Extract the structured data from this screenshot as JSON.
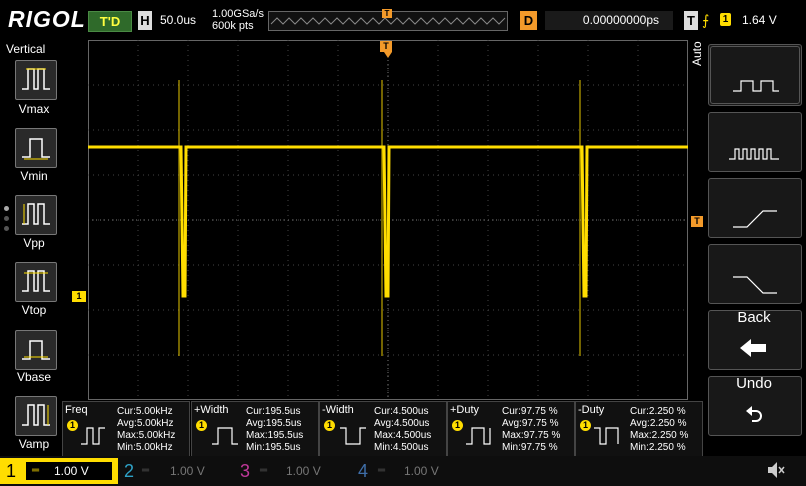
{
  "header": {
    "brand": "RIGOL",
    "run_status": "T'D",
    "horizontal_badge": "H",
    "timebase": "50.0us",
    "sample_rate": "1.00GSa/s",
    "memory_depth": "600k pts",
    "trigger_map_marker": "T",
    "delay_badge": "D",
    "delay_value": "0.00000000ps",
    "trigger_badge": "T",
    "trigger_edge": "⨍",
    "trigger_channel": "1",
    "trigger_level": "1.64 V"
  },
  "left_panel": {
    "title": "Vertical",
    "items": [
      {
        "label": "Vmax"
      },
      {
        "label": "Vmin"
      },
      {
        "label": "Vpp"
      },
      {
        "label": "Vtop"
      },
      {
        "label": "Vbase"
      },
      {
        "label": "Vamp"
      }
    ]
  },
  "waveform": {
    "top_marker": "T",
    "channel_marker": "1",
    "trigger_level_marker": "T"
  },
  "right_panel": {
    "mode": "Auto",
    "back_label": "Back",
    "undo_label": "Undo"
  },
  "measurements": [
    {
      "name": "Freq",
      "channel": "1",
      "cur": "Cur:5.00kHz",
      "avg": "Avg:5.00kHz",
      "max": "Max:5.00kHz",
      "min": "Min:5.00kHz"
    },
    {
      "name": "+Width",
      "channel": "1",
      "cur": "Cur:195.5us",
      "avg": "Avg:195.5us",
      "max": "Max:195.5us",
      "min": "Min:195.5us"
    },
    {
      "name": "-Width",
      "channel": "1",
      "cur": "Cur:4.500us",
      "avg": "Avg:4.500us",
      "max": "Max:4.500us",
      "min": "Min:4.500us"
    },
    {
      "name": "+Duty",
      "channel": "1",
      "cur": "Cur:97.75 %",
      "avg": "Avg:97.75 %",
      "max": "Max:97.75 %",
      "min": "Min:97.75 %"
    },
    {
      "name": "-Duty",
      "channel": "1",
      "cur": "Cur:2.250 %",
      "avg": "Avg:2.250 %",
      "max": "Max:2.250 %",
      "min": "Min:2.250 %"
    }
  ],
  "channels": [
    {
      "num": "1",
      "coupling": "═",
      "scale": "1.00 V",
      "color": "#ffdd00"
    },
    {
      "num": "2",
      "coupling": "═",
      "scale": "1.00 V",
      "color": "#2fa3c8"
    },
    {
      "num": "3",
      "coupling": "═",
      "scale": "1.00 V",
      "color": "#c0389a"
    },
    {
      "num": "4",
      "coupling": "═",
      "scale": "1.00 V",
      "color": "#3f6ea8"
    }
  ],
  "colors": {
    "ch1": "#ffdd00",
    "trigger": "#f39a2a",
    "grid": "#555555"
  }
}
